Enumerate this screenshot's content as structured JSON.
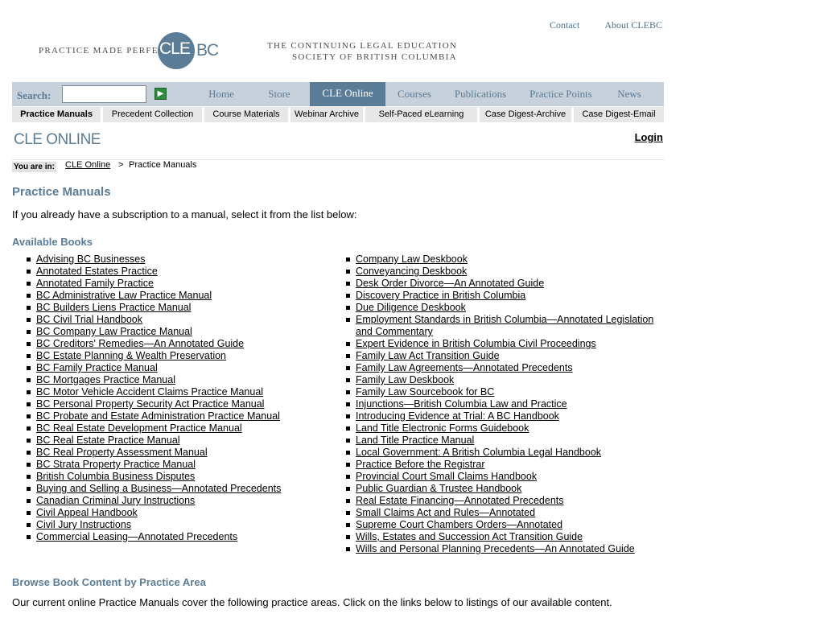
{
  "header": {
    "top_links": [
      "Contact",
      "About CLEBC"
    ],
    "logo": {
      "tagline": "PRACTICE MADE PERFECT",
      "cle": "CLE",
      "bc": "BC"
    },
    "society_line1": "THE CONTINUING LEGAL EDUCATION",
    "society_line2": "SOCIETY OF BRITISH COLUMBIA"
  },
  "search": {
    "label": "Search:",
    "value": "",
    "go_icon": "arrow-right-icon"
  },
  "nav": {
    "tabs": [
      "Home",
      "Store",
      "CLE Online",
      "Courses",
      "Publications",
      "Practice Points",
      "News"
    ],
    "active": "CLE Online"
  },
  "subnav": {
    "tabs": [
      "Practice Manuals",
      "Precedent Collection",
      "Course Materials",
      "Webinar Archive",
      "Self-Paced eLearning",
      "Case Digest-Archive",
      "Case Digest-Email"
    ],
    "active": "Practice Manuals"
  },
  "section_title": "CLE ONLINE",
  "login_label": "Login",
  "breadcrumb": {
    "you_are_in": "You are in:",
    "link": "CLE Online",
    "separator": ">",
    "current": "Practice Manuals"
  },
  "page_title": "Practice Manuals",
  "intro_text": "If you already have a subscription to a manual, select it from the list below:",
  "available_heading": "Available Books",
  "books_left": [
    "Advising BC Businesses",
    "Annotated Estates Practice",
    "Annotated Family Practice",
    "BC Administrative Law Practice Manual",
    "BC Builders Liens Practice Manual",
    "BC Civil Trial Handbook",
    "BC Company Law Practice Manual",
    "BC Creditors' Remedies—An Annotated Guide",
    "BC Estate Planning & Wealth Preservation",
    "BC Family Practice Manual",
    "BC Mortgages Practice Manual",
    "BC Motor Vehicle Accident Claims Practice Manual",
    "BC Personal Property Security Act Practice Manual",
    "BC Probate and Estate Administration Practice Manual",
    "BC Real Estate Development Practice Manual",
    "BC Real Estate Practice Manual",
    "BC Real Property Assessment Manual",
    "BC Strata Property Practice Manual",
    "British Columbia Business Disputes",
    "Buying and Selling a Business—Annotated Precedents",
    "Canadian Criminal Jury Instructions",
    "Civil Appeal Handbook",
    "Civil Jury Instructions",
    "Commercial Leasing—Annotated Precedents"
  ],
  "books_right": [
    "Company Law Deskbook",
    "Conveyancing Deskbook",
    "Desk Order Divorce—An Annotated Guide",
    "Discovery Practice in British Columbia",
    "Due Diligence Deskbook",
    "Employment Standards in British Columbia—Annotated Legislation and Commentary",
    "Expert Evidence in British Columbia Civil Proceedings",
    "Family Law Act Transition Guide",
    "Family Law Agreements—Annotated Precedents",
    "Family Law Deskbook",
    "Family Law Sourcebook for BC",
    "Injunctions—British Columbia Law and Practice",
    "Introducing Evidence at Trial: A BC Handbook",
    "Land Title Electronic Forms Guidebook",
    "Land Title Practice Manual",
    "Local Government: A British Columbia Legal Handbook",
    "Practice Before the Registrar",
    "Provincial Court Small Claims Handbook",
    "Public Guardian & Trustee Handbook",
    "Real Estate Financing—Annotated Precedents",
    "Small Claims Act and Rules—Annotated",
    "Supreme Court Chambers Orders—Annotated",
    "Wills, Estates and Succession Act Transition Guide",
    "Wills and Personal Planning Precedents—An Annotated Guide"
  ],
  "browse_heading": "Browse Book Content by Practice Area",
  "browse_text": "Our current online Practice Manuals cover the following practice areas. Click on the links below to listings of our available content.",
  "colors": {
    "accent": "#5b7c96",
    "navbar_bg": "#c7d1db",
    "subnav_bg": "#e7e7e7"
  }
}
